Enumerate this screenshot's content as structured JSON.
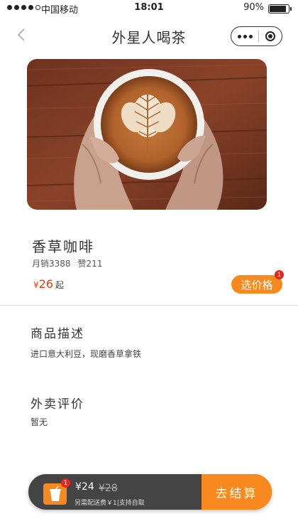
{
  "status_bar": {
    "carrier": "中国移动",
    "time": "18:01",
    "battery": "90%",
    "battery_level": 0.9
  },
  "nav": {
    "title": "外星人喝茶"
  },
  "product": {
    "name": "香草咖啡",
    "monthly_sales": "月销3388",
    "likes": "赞211",
    "price_symbol": "¥",
    "price": "26",
    "price_suffix": "起",
    "choose_button": "选价格",
    "choose_badge": "1"
  },
  "description": {
    "title": "商品描述",
    "text": "进口意大利豆，现磨香草拿铁"
  },
  "reviews": {
    "title": "外卖评价",
    "text": "暂无"
  },
  "cart": {
    "badge": "1",
    "total": "¥24",
    "original": "¥28",
    "fee_note": "另需配送费￥1|支持自取",
    "checkout": "去结算"
  }
}
